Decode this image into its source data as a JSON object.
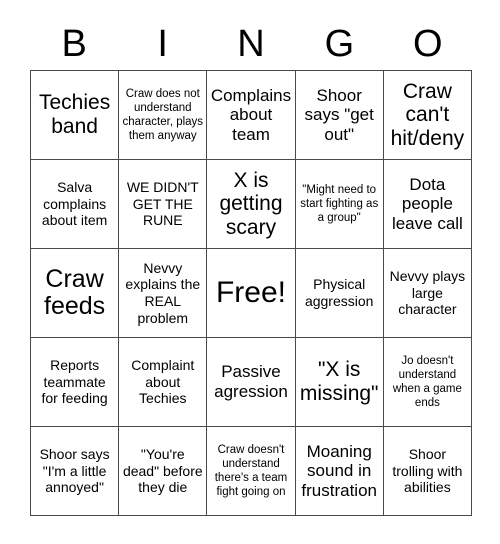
{
  "card": {
    "title": "BINGO",
    "header_letters": [
      "B",
      "I",
      "N",
      "G",
      "O"
    ],
    "rows": [
      [
        {
          "text": "Techies band",
          "size": "fs-lg"
        },
        {
          "text": "Craw does not understand character, plays them anyway",
          "size": "fs-xs"
        },
        {
          "text": "Complains about team",
          "size": "fs-md"
        },
        {
          "text": "Shoor says \"get out\"",
          "size": "fs-md"
        },
        {
          "text": "Craw can't hit/deny",
          "size": "fs-lg"
        }
      ],
      [
        {
          "text": "Salva complains about item",
          "size": "fs-sm"
        },
        {
          "text": "WE DIDN'T GET THE RUNE",
          "size": "fs-sm"
        },
        {
          "text": "X is getting scary",
          "size": "fs-lg"
        },
        {
          "text": "\"Might need to start fighting as a group\"",
          "size": "fs-xs"
        },
        {
          "text": "Dota people leave call",
          "size": "fs-md"
        }
      ],
      [
        {
          "text": "Craw feeds",
          "size": "fs-xl"
        },
        {
          "text": "Nevvy explains the REAL problem",
          "size": "fs-sm"
        },
        {
          "text": "Free!",
          "size": "fs-free"
        },
        {
          "text": "Physical aggression",
          "size": "fs-sm"
        },
        {
          "text": "Nevvy plays large character",
          "size": "fs-sm"
        }
      ],
      [
        {
          "text": "Reports teammate for feeding",
          "size": "fs-sm"
        },
        {
          "text": "Complaint about Techies",
          "size": "fs-sm"
        },
        {
          "text": "Passive agression",
          "size": "fs-md"
        },
        {
          "text": "\"X is missing\"",
          "size": "fs-lg"
        },
        {
          "text": "Jo doesn't understand when a game ends",
          "size": "fs-xs"
        }
      ],
      [
        {
          "text": "Shoor says \"I'm a little annoyed\"",
          "size": "fs-sm"
        },
        {
          "text": "\"You're dead\" before they die",
          "size": "fs-sm"
        },
        {
          "text": "Craw doesn't understand there's a team fight going on",
          "size": "fs-xs"
        },
        {
          "text": "Moaning sound in frustration",
          "size": "fs-md"
        },
        {
          "text": "Shoor trolling with abilities",
          "size": "fs-sm"
        }
      ]
    ]
  },
  "colors": {
    "border": "#4a4a4a",
    "text": "#000000",
    "background": "#ffffff"
  }
}
